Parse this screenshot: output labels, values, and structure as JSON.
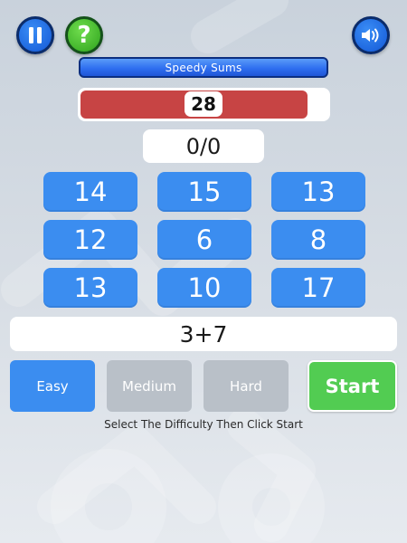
{
  "header": {
    "pause_icon": "pause-icon",
    "help_label": "?",
    "sound_icon": "speaker-icon"
  },
  "title": "Speedy Sums",
  "timer": {
    "value": "28",
    "fill_fraction": 0.92,
    "fill_color": "#c74444"
  },
  "score": "0/0",
  "answers": [
    "14",
    "15",
    "13",
    "12",
    "6",
    "8",
    "13",
    "10",
    "17"
  ],
  "question": "3+7",
  "difficulty": {
    "easy": "Easy",
    "medium": "Medium",
    "hard": "Hard",
    "selected": "Easy"
  },
  "start_label": "Start",
  "instruction": "Select The Difficulty Then Click Start",
  "colors": {
    "tile_blue": "#3b8df0",
    "start_green": "#52cc52",
    "disabled_gray": "#b9c0c8"
  }
}
